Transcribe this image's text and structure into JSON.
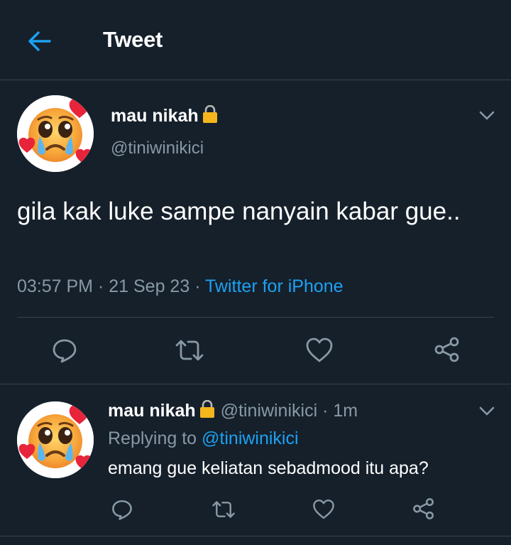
{
  "header": {
    "title": "Tweet"
  },
  "tweet": {
    "author_name": "mau nikah",
    "author_handle": "@tiniwinikici",
    "text": "gila kak luke sampe nanyain kabar gue..",
    "time": "03:57 PM",
    "date": "21 Sep 23",
    "source": "Twitter for iPhone",
    "sep": "·"
  },
  "reply": {
    "author_name": "mau nikah",
    "author_handle": "@tiniwinikici",
    "time": "1m",
    "replying_prefix": "Replying to",
    "replying_to": "@tiniwinikici",
    "text": "emang gue keliatan sebadmood itu apa?",
    "sep": "·"
  },
  "colors": {
    "background": "#15202b",
    "secondary_text": "#8899a6",
    "accent": "#1da1f2",
    "divider": "#38444d"
  },
  "icons": {
    "back": "arrow-left-icon",
    "lock": "lock-icon",
    "menu": "chevron-down-icon",
    "reply": "comment-icon",
    "retweet": "retweet-icon",
    "like": "heart-icon",
    "share": "share-icon",
    "avatar": "pleading-face-hearts-emoji"
  }
}
